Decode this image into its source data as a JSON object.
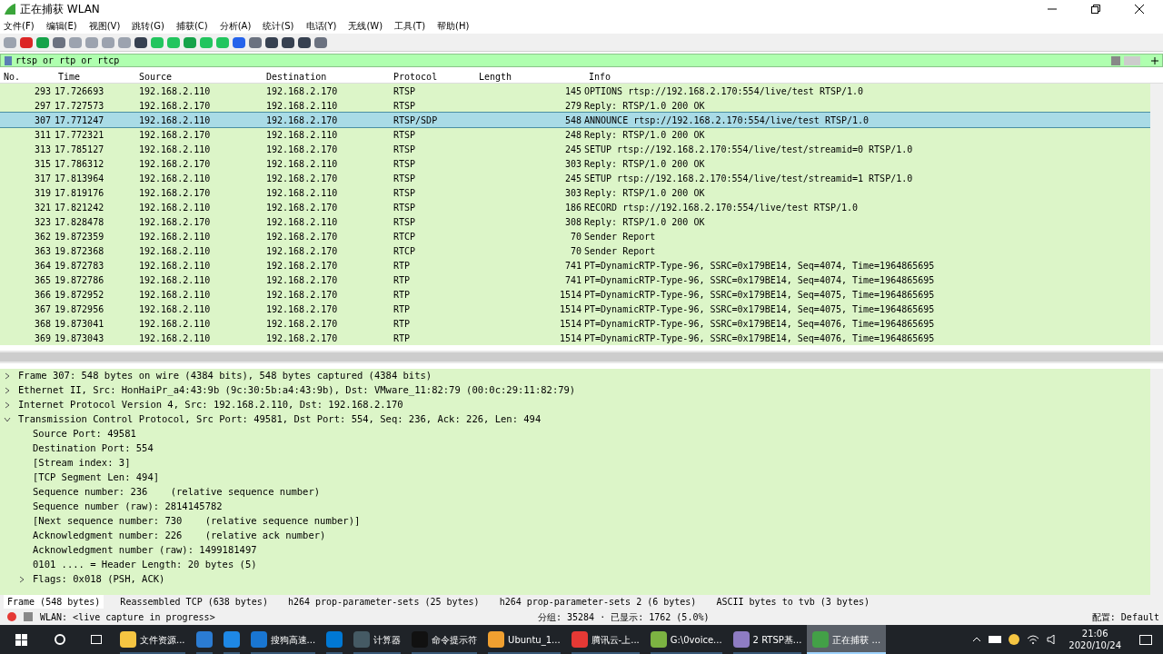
{
  "window": {
    "title": "正在捕获 WLAN"
  },
  "menu": [
    "文件(F)",
    "编辑(E)",
    "视图(V)",
    "跳转(G)",
    "捕获(C)",
    "分析(A)",
    "统计(S)",
    "电话(Y)",
    "无线(W)",
    "工具(T)",
    "帮助(H)"
  ],
  "filter": {
    "value": "rtsp or rtp or rtcp"
  },
  "columns": [
    "No.",
    "Time",
    "Source",
    "Destination",
    "Protocol",
    "Length",
    "Info"
  ],
  "packets": [
    {
      "no": "293",
      "time": "17.726693",
      "source": "192.168.2.110",
      "destination": "192.168.2.170",
      "protocol": "RTSP",
      "length": "145",
      "info": "OPTIONS rtsp://192.168.2.170:554/live/test RTSP/1.0",
      "selected": false
    },
    {
      "no": "297",
      "time": "17.727573",
      "source": "192.168.2.170",
      "destination": "192.168.2.110",
      "protocol": "RTSP",
      "length": "279",
      "info": "Reply: RTSP/1.0 200 OK",
      "selected": false
    },
    {
      "no": "307",
      "time": "17.771247",
      "source": "192.168.2.110",
      "destination": "192.168.2.170",
      "protocol": "RTSP/SDP",
      "length": "548",
      "info": "ANNOUNCE rtsp://192.168.2.170:554/live/test RTSP/1.0",
      "selected": true
    },
    {
      "no": "311",
      "time": "17.772321",
      "source": "192.168.2.170",
      "destination": "192.168.2.110",
      "protocol": "RTSP",
      "length": "248",
      "info": "Reply: RTSP/1.0 200 OK",
      "selected": false
    },
    {
      "no": "313",
      "time": "17.785127",
      "source": "192.168.2.110",
      "destination": "192.168.2.170",
      "protocol": "RTSP",
      "length": "245",
      "info": "SETUP rtsp://192.168.2.170:554/live/test/streamid=0 RTSP/1.0",
      "selected": false
    },
    {
      "no": "315",
      "time": "17.786312",
      "source": "192.168.2.170",
      "destination": "192.168.2.110",
      "protocol": "RTSP",
      "length": "303",
      "info": "Reply: RTSP/1.0 200 OK",
      "selected": false
    },
    {
      "no": "317",
      "time": "17.813964",
      "source": "192.168.2.110",
      "destination": "192.168.2.170",
      "protocol": "RTSP",
      "length": "245",
      "info": "SETUP rtsp://192.168.2.170:554/live/test/streamid=1 RTSP/1.0",
      "selected": false
    },
    {
      "no": "319",
      "time": "17.819176",
      "source": "192.168.2.170",
      "destination": "192.168.2.110",
      "protocol": "RTSP",
      "length": "303",
      "info": "Reply: RTSP/1.0 200 OK",
      "selected": false
    },
    {
      "no": "321",
      "time": "17.821242",
      "source": "192.168.2.110",
      "destination": "192.168.2.170",
      "protocol": "RTSP",
      "length": "186",
      "info": "RECORD rtsp://192.168.2.170:554/live/test RTSP/1.0",
      "selected": false
    },
    {
      "no": "323",
      "time": "17.828478",
      "source": "192.168.2.170",
      "destination": "192.168.2.110",
      "protocol": "RTSP",
      "length": "308",
      "info": "Reply: RTSP/1.0 200 OK",
      "selected": false
    },
    {
      "no": "362",
      "time": "19.872359",
      "source": "192.168.2.110",
      "destination": "192.168.2.170",
      "protocol": "RTCP",
      "length": "70",
      "info": "Sender Report",
      "selected": false
    },
    {
      "no": "363",
      "time": "19.872368",
      "source": "192.168.2.110",
      "destination": "192.168.2.170",
      "protocol": "RTCP",
      "length": "70",
      "info": "Sender Report",
      "selected": false
    },
    {
      "no": "364",
      "time": "19.872783",
      "source": "192.168.2.110",
      "destination": "192.168.2.170",
      "protocol": "RTP",
      "length": "741",
      "info": "PT=DynamicRTP-Type-96, SSRC=0x179BE14, Seq=4074, Time=1964865695",
      "selected": false
    },
    {
      "no": "365",
      "time": "19.872786",
      "source": "192.168.2.110",
      "destination": "192.168.2.170",
      "protocol": "RTP",
      "length": "741",
      "info": "PT=DynamicRTP-Type-96, SSRC=0x179BE14, Seq=4074, Time=1964865695",
      "selected": false
    },
    {
      "no": "366",
      "time": "19.872952",
      "source": "192.168.2.110",
      "destination": "192.168.2.170",
      "protocol": "RTP",
      "length": "1514",
      "info": "PT=DynamicRTP-Type-96, SSRC=0x179BE14, Seq=4075, Time=1964865695",
      "selected": false
    },
    {
      "no": "367",
      "time": "19.872956",
      "source": "192.168.2.110",
      "destination": "192.168.2.170",
      "protocol": "RTP",
      "length": "1514",
      "info": "PT=DynamicRTP-Type-96, SSRC=0x179BE14, Seq=4075, Time=1964865695",
      "selected": false
    },
    {
      "no": "368",
      "time": "19.873041",
      "source": "192.168.2.110",
      "destination": "192.168.2.170",
      "protocol": "RTP",
      "length": "1514",
      "info": "PT=DynamicRTP-Type-96, SSRC=0x179BE14, Seq=4076, Time=1964865695",
      "selected": false
    },
    {
      "no": "369",
      "time": "19.873043",
      "source": "192.168.2.110",
      "destination": "192.168.2.170",
      "protocol": "RTP",
      "length": "1514",
      "info": "PT=DynamicRTP-Type-96, SSRC=0x179BE14, Seq=4076, Time=1964865695",
      "selected": false
    }
  ],
  "details": [
    {
      "text": "Frame 307: 548 bytes on wire (4384 bits), 548 bytes captured (4384 bits)",
      "expanded": false
    },
    {
      "text": "Ethernet II, Src: HonHaiPr_a4:43:9b (9c:30:5b:a4:43:9b), Dst: VMware_11:82:79 (00:0c:29:11:82:79)",
      "expanded": false
    },
    {
      "text": "Internet Protocol Version 4, Src: 192.168.2.110, Dst: 192.168.2.170",
      "expanded": false
    },
    {
      "text": "Transmission Control Protocol, Src Port: 49581, Dst Port: 554, Seq: 236, Ack: 226, Len: 494",
      "expanded": true,
      "children": [
        {
          "text": "Source Port: 49581"
        },
        {
          "text": "Destination Port: 554"
        },
        {
          "text": "[Stream index: 3]"
        },
        {
          "text": "[TCP Segment Len: 494]"
        },
        {
          "text": "Sequence number: 236    (relative sequence number)"
        },
        {
          "text": "Sequence number (raw): 2814145782"
        },
        {
          "text": "[Next sequence number: 730    (relative sequence number)]"
        },
        {
          "text": "Acknowledgment number: 226    (relative ack number)"
        },
        {
          "text": "Acknowledgment number (raw): 1499181497"
        },
        {
          "text": "0101 .... = Header Length: 20 bytes (5)"
        },
        {
          "text": "Flags: 0x018 (PSH, ACK)",
          "expanded": false
        }
      ]
    }
  ],
  "byte_tabs": [
    {
      "label": "Frame (548 bytes)",
      "selected": true
    },
    {
      "label": "Reassembled TCP (638 bytes)",
      "selected": false
    },
    {
      "label": "h264 prop-parameter-sets (25 bytes)",
      "selected": false
    },
    {
      "label": "h264 prop-parameter-sets 2 (6 bytes)",
      "selected": false
    },
    {
      "label": "ASCII bytes to tvb (3 bytes)",
      "selected": false
    }
  ],
  "status_bar": {
    "capture": "WLAN: <live capture in progress>",
    "packets": "分组: 35284 · 已显示: 1762 (5.0%)",
    "profile": "配置: Default"
  },
  "taskbar": {
    "apps": [
      {
        "label": "文件资源...",
        "active": false
      },
      {
        "active": false
      },
      {
        "active": false
      },
      {
        "label": "搜狗高速...",
        "active": false
      },
      {
        "active": false
      },
      {
        "label": "计算器",
        "active": false
      },
      {
        "label": "命令提示符",
        "active": false
      },
      {
        "label": "Ubuntu_1...",
        "active": false
      },
      {
        "label": "腾讯云-上...",
        "active": false
      },
      {
        "label": "G:\\0voice...",
        "active": false
      },
      {
        "label": "2 RTSP基...",
        "active": false
      },
      {
        "label": "正在捕获 ...",
        "active": true
      }
    ],
    "time": "21:06",
    "date": "2020/10/24"
  }
}
